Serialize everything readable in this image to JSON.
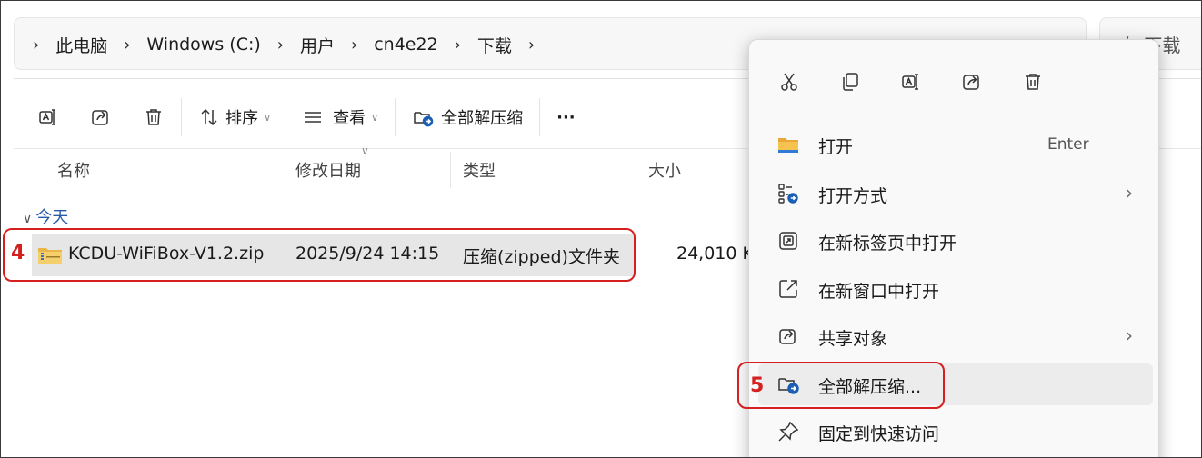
{
  "breadcrumb": {
    "items": [
      "此电脑",
      "Windows (C:)",
      "用户",
      "cn4e22",
      "下载"
    ],
    "separator": "›"
  },
  "search": {
    "placeholder": "在 下载"
  },
  "toolbar": {
    "sort_label": "排序",
    "view_label": "查看",
    "extract_label": "全部解压缩",
    "more_label": "···"
  },
  "columns": {
    "name": "名称",
    "modified": "修改日期",
    "type": "类型",
    "size": "大小"
  },
  "group": {
    "label": "今天"
  },
  "file": {
    "name": "KCDU-WiFiBox-V1.2.zip",
    "modified": "2025/9/24 14:15",
    "type": "压缩(zipped)文件夹",
    "size": "24,010 K"
  },
  "annotations": {
    "step4": "4",
    "step5": "5"
  },
  "context_menu": {
    "items": [
      {
        "label": "打开",
        "accelerator": "Enter",
        "icon": "folder-icon"
      },
      {
        "label": "打开方式",
        "icon": "open-with-icon",
        "submenu": "›"
      },
      {
        "label": "在新标签页中打开",
        "icon": "new-tab-icon"
      },
      {
        "label": "在新窗口中打开",
        "icon": "new-window-icon"
      },
      {
        "label": "共享对象",
        "icon": "share-icon",
        "submenu": "›"
      },
      {
        "label": "全部解压缩...",
        "icon": "extract-icon"
      },
      {
        "label": "固定到快速访问",
        "icon": "pin-icon"
      }
    ]
  },
  "colors": {
    "accent_red": "#d42020",
    "selection_bg": "#e6e6e6",
    "link_blue": "#2a5ba8"
  }
}
